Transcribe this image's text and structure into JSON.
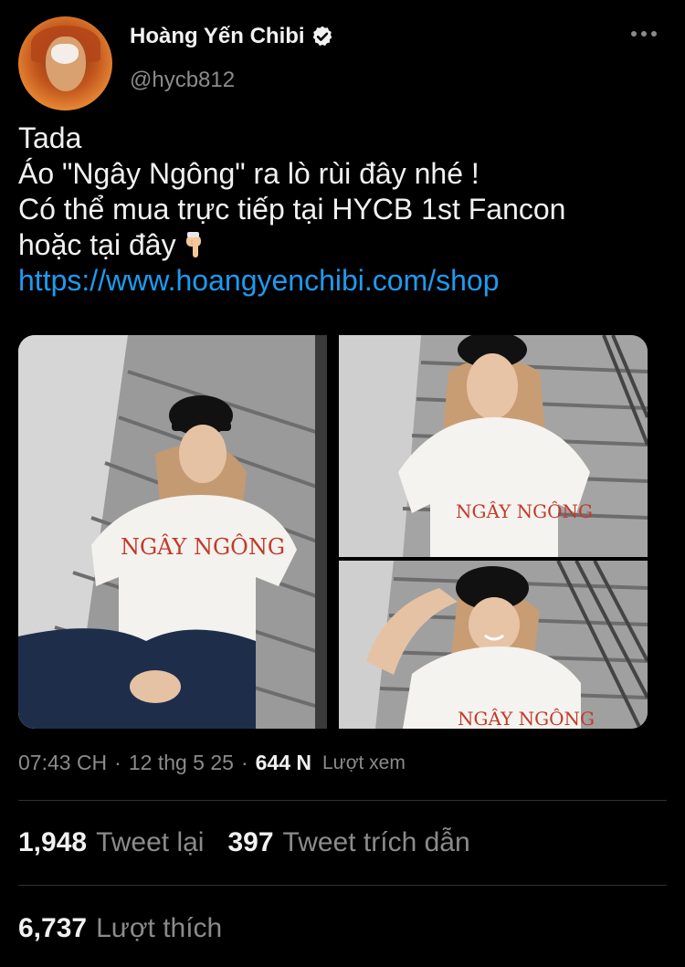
{
  "profile": {
    "display_name": "Hoàng Yến Chibi",
    "handle": "@hycb812",
    "verified_icon": "verified-badge-icon",
    "more_icon": "more-options-icon"
  },
  "tweet": {
    "lines": [
      "Tada",
      "Áo \"Ngây Ngông\" ra lò rùi đây nhé !",
      "Có thể mua trực tiếp tại HYCB 1st Fancon",
      "hoặc tại đây"
    ],
    "hand_emoji_icon": "pointing-down-hand-icon",
    "link": "https://www.hoangyenchibi.com/shop"
  },
  "media": {
    "shirt_text": "NGÂY NGÔNG"
  },
  "meta": {
    "time": "07:43 CH",
    "separator": "·",
    "date": "12 thg 5 25",
    "views_count": "644 N",
    "views_label": "Lượt xem"
  },
  "stats": {
    "retweets_count": "1,948",
    "retweets_label": "Tweet lại",
    "quotes_count": "397",
    "quotes_label": "Tweet trích dẫn",
    "likes_count": "6,737",
    "likes_label": "Lượt thích"
  },
  "colors": {
    "background": "#000000",
    "link": "#1d9bf0",
    "secondary_text": "#8b8b8b",
    "primary_text": "#f1f1f1"
  }
}
